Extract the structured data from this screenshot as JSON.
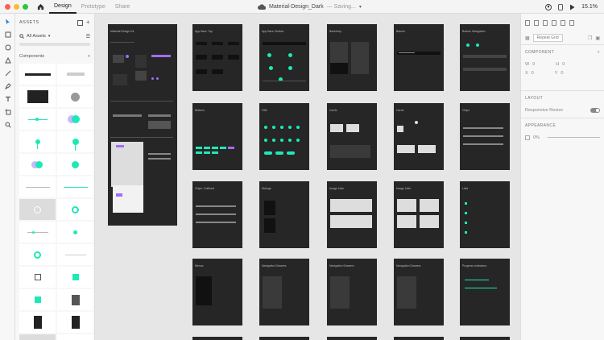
{
  "window": {
    "traffic_colors": [
      "#fd5f57",
      "#fdbc2e",
      "#28c840"
    ],
    "tabs": [
      {
        "label": "Design",
        "active": true
      },
      {
        "label": "Prototype",
        "active": false
      },
      {
        "label": "Share",
        "active": false
      }
    ],
    "doc_name": "Material-Design_Dark",
    "doc_status": "— Saving...",
    "zoom": "15.1%"
  },
  "assets": {
    "header": "ASSETS",
    "filter_label": "All Assets",
    "components_label": "Components"
  },
  "canvas": {
    "background": "#e6e6e6",
    "artboard_color": "#262626",
    "accent_teal": "#1de9b6",
    "accent_purple": "#a06dff",
    "artboards": [
      {
        "title": "Material Design Kit"
      },
      {
        "title": "App Bars: Top"
      },
      {
        "title": "App Bars: Bottom"
      },
      {
        "title": "Backdrop"
      },
      {
        "title": "Banner"
      },
      {
        "title": "Bottom Navigation"
      },
      {
        "title": "Buttons"
      },
      {
        "title": "FAB"
      },
      {
        "title": "Cards"
      },
      {
        "title": "Cards"
      },
      {
        "title": "Chips"
      },
      {
        "title": "Chips: Outlined"
      },
      {
        "title": "Dialogs"
      },
      {
        "title": "Image Lists"
      },
      {
        "title": "Image Lists"
      },
      {
        "title": "Lists"
      },
      {
        "title": "Menus"
      },
      {
        "title": "Navigation Drawers"
      },
      {
        "title": "Navigation Drawers"
      },
      {
        "title": "Navigation Drawers"
      },
      {
        "title": "Progress Indicators"
      }
    ]
  },
  "props": {
    "repeat_grid": "Repeat Grid",
    "component_label": "COMPONENT",
    "w_label": "W",
    "w_value": "0",
    "h_label": "H",
    "h_value": "0",
    "x_label": "X",
    "x_value": "0",
    "y_label": "Y",
    "y_value": "0",
    "layout_label": "LAYOUT",
    "responsive_label": "Responsive Resize",
    "appearance_label": "APPEARANCE",
    "opacity_value": "0%"
  }
}
